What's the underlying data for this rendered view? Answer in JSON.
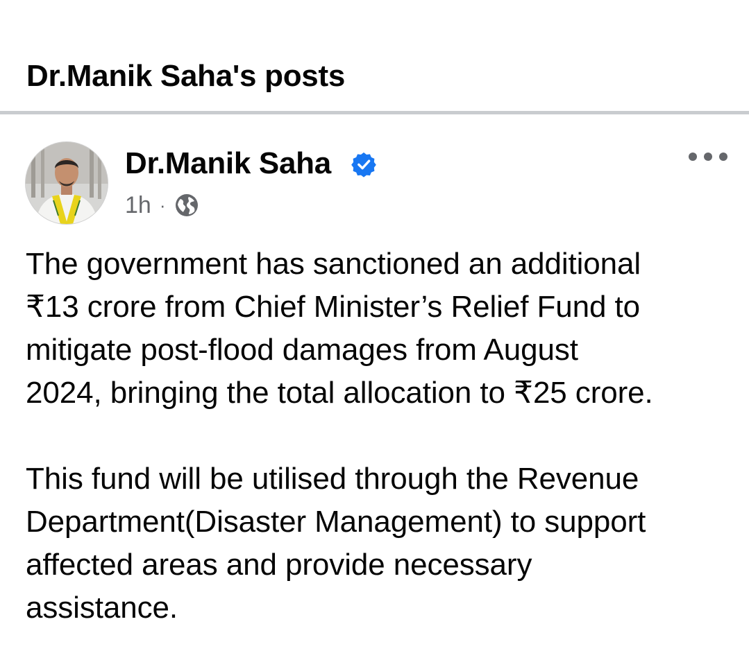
{
  "page": {
    "title": "Dr.Manik Saha's posts"
  },
  "post": {
    "author": "Dr.Manik Saha",
    "verified": true,
    "timestamp": "1h",
    "separator": "·",
    "audience_icon": "globe-icon",
    "more_icon": "more-options-icon",
    "paragraphs": [
      "The government has sanctioned an additional\n₹13 crore from Chief Minister’s Relief Fund to\nmitigate post-flood damages from August\n2024, bringing the total allocation to ₹25 crore.",
      "This fund will be utilised through the Revenue\nDepartment(Disaster Management) to support\naffected areas and provide necessary\nassistance."
    ]
  },
  "colors": {
    "text": "#050505",
    "secondary_text": "#65676b",
    "verified_badge": "#1877f2",
    "divider": "#c9cccf"
  }
}
